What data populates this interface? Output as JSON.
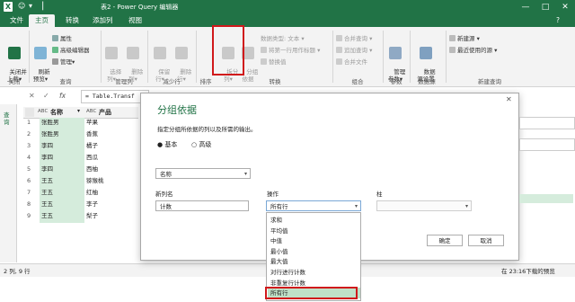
{
  "titlebar": {
    "title": "表2 - Power Query 编辑器",
    "icon_letter": "X",
    "save_icon": "☺",
    "menu_icon": "▾",
    "help": "?",
    "minimize": "—",
    "maximize": "□",
    "close": "✕"
  },
  "tabs": [
    "文件",
    "主页",
    "转换",
    "添加列",
    "视图"
  ],
  "ribbon": {
    "close_upload": "关闭并\n上载▾",
    "refresh_preview": "刷新\n预览▾",
    "properties": "属性",
    "advanced_editor": "高级编辑器",
    "manage": "管理▾",
    "choose_columns": "选择\n列▾",
    "remove_columns": "删除\n列▾",
    "keep_rows": "保留\n行▾",
    "remove_rows": "删除\n行▾",
    "split_column": "拆分\n列▾",
    "group_by": "分组\n依据",
    "data_type": "数据类型: 文本 ▾",
    "first_row_header": "将第一行用作标题 ▾",
    "replace_values": "替换值",
    "merge_queries": "合并查询 ▾",
    "append_queries": "追加查询 ▾",
    "merge_files": "合并文件",
    "manage_params": "管理\n参数▾",
    "data_source_settings": "数据\n源设置",
    "new_source": "新建源 ▾",
    "recent_sources": "最近使用的源 ▾",
    "groups": {
      "close": "关闭",
      "query": "查询",
      "manage_cols": "管理列",
      "reduce_rows": "减少行",
      "sort": "排序",
      "transform": "转换",
      "combine": "组合",
      "params": "参数",
      "datasource": "数据源",
      "new_query": "新建查询"
    }
  },
  "formula": {
    "text": "= Table.Transf",
    "fx": "fx",
    "check": "✓",
    "cross": "✕"
  },
  "querystrip": {
    "label": "查询"
  },
  "grid": {
    "col1_header": "名称",
    "col2_header": "产品",
    "col1_type": "ABC",
    "rows": [
      {
        "n": "1",
        "name": "张胜男",
        "product": "苹果"
      },
      {
        "n": "2",
        "name": "张胜男",
        "product": "香蕉"
      },
      {
        "n": "3",
        "name": "李四",
        "product": "橘子"
      },
      {
        "n": "4",
        "name": "李四",
        "product": "西瓜"
      },
      {
        "n": "5",
        "name": "李四",
        "product": "西柚"
      },
      {
        "n": "6",
        "name": "王五",
        "product": "猕猴桃"
      },
      {
        "n": "7",
        "name": "王五",
        "product": "红柚"
      },
      {
        "n": "8",
        "name": "王五",
        "product": "李子"
      },
      {
        "n": "9",
        "name": "王五",
        "product": "梨子"
      }
    ]
  },
  "status": {
    "left": "2 列, 9 行",
    "right": "在 23:16下载的预览"
  },
  "dialog": {
    "title": "分组依据",
    "subtitle": "指定分组所依据的列以及所需的输出。",
    "radio_basic": "基本",
    "radio_advanced": "高级",
    "group_column": "名称",
    "new_col_label": "新列名",
    "new_col_value": "计数",
    "op_label": "操作",
    "op_value": "所有行",
    "col_label": "柱",
    "ok": "确定",
    "cancel": "取消",
    "close": "✕"
  },
  "operations": [
    "求和",
    "平均值",
    "中值",
    "最小值",
    "最大值",
    "对行进行计数",
    "非重复行计数",
    "所有行"
  ],
  "colors": {
    "accent": "#217346",
    "red_highlight": "#d0191b",
    "selected_opt": "#bfe1c8"
  }
}
